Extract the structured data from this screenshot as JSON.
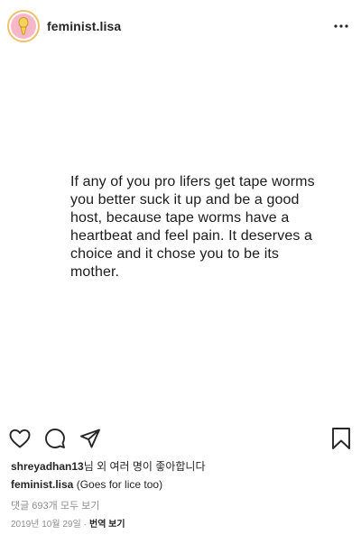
{
  "header": {
    "username": "feminist.lisa"
  },
  "post": {
    "text": "If any of you pro lifers get tape worms\nyou better suck it up and be a good\nhost, because tape worms have a\nheartbeat and feel pain. It deserves a\nchoice and it chose you to be its\nmother."
  },
  "likes": {
    "user": "shreyadhan13",
    "suffix": "님 외 여러 명이 좋아합니다"
  },
  "caption": {
    "username": "feminist.lisa",
    "text": "(Goes for lice too)"
  },
  "comments_link": "댓글 693개 모두 보기",
  "meta": {
    "date": "2019년 10월 29일",
    "separator": "·",
    "translate": "번역 보기"
  },
  "icons": {
    "like": "heart-icon",
    "comment": "comment-icon",
    "share": "send-icon",
    "save": "bookmark-icon",
    "more": "more-icon"
  },
  "colors": {
    "avatar_ring": "#f2c06d",
    "avatar_bg": "#f6b7c9",
    "secondary_text": "#8e8e8e"
  }
}
